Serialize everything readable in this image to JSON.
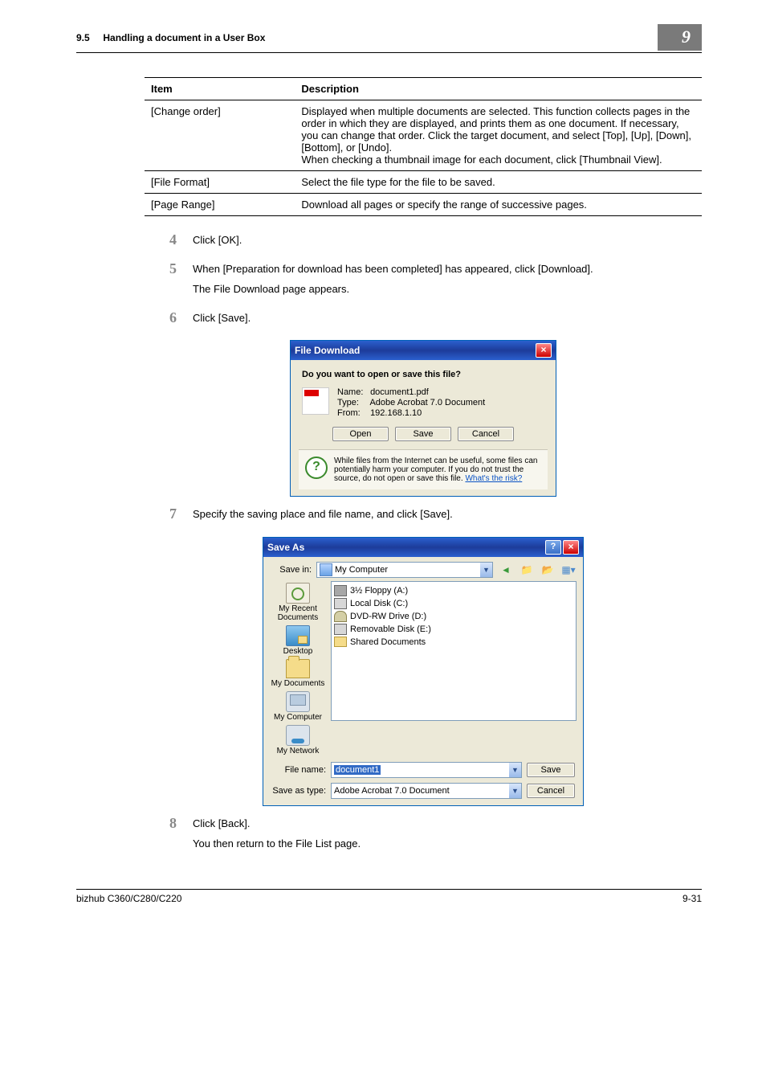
{
  "header": {
    "section": "9.5",
    "title": "Handling a document in a User Box",
    "chapter": "9"
  },
  "table": {
    "head": {
      "item": "Item",
      "description": "Description"
    },
    "rows": [
      {
        "item": "[Change order]",
        "description": "Displayed when multiple documents are selected. This function collects pages in the order in which they are displayed, and prints them as one document. If necessary, you can change that order. Click the target document, and select [Top], [Up], [Down], [Bottom], or [Undo].\nWhen checking a thumbnail image for each document, click [Thumbnail View]."
      },
      {
        "item": "[File Format]",
        "description": "Select the file type for the file to be saved."
      },
      {
        "item": "[Page Range]",
        "description": "Download all pages or specify the range of successive pages."
      }
    ]
  },
  "steps": {
    "s4": {
      "num": "4",
      "line1": "Click [OK]."
    },
    "s5": {
      "num": "5",
      "line1": "When [Preparation for download has been completed] has appeared, click [Download].",
      "line2": "The File Download page appears."
    },
    "s6": {
      "num": "6",
      "line1": "Click [Save]."
    },
    "s7": {
      "num": "7",
      "line1": "Specify the saving place and file name, and click [Save]."
    },
    "s8": {
      "num": "8",
      "line1": "Click [Back].",
      "line2": "You then return to the File List page."
    }
  },
  "fileDownload": {
    "title": "File Download",
    "prompt": "Do you want to open or save this file?",
    "nameLabel": "Name:",
    "nameValue": "document1.pdf",
    "typeLabel": "Type:",
    "typeValue": "Adobe Acrobat 7.0 Document",
    "fromLabel": "From:",
    "fromValue": "192.168.1.10",
    "open": "Open",
    "save": "Save",
    "cancel": "Cancel",
    "warning": "While files from the Internet can be useful, some files can potentially harm your computer. If you do not trust the source, do not open or save this file. ",
    "warnLink": "What's the risk?"
  },
  "saveAs": {
    "title": "Save As",
    "saveInLabel": "Save in:",
    "saveInValue": "My Computer",
    "places": {
      "recent": "My Recent Documents",
      "desktop": "Desktop",
      "mydocs": "My Documents",
      "mycomp": "My Computer",
      "mynet": "My Network"
    },
    "drives": {
      "a": "3½ Floppy (A:)",
      "c": "Local Disk (C:)",
      "d": "DVD-RW Drive (D:)",
      "e": "Removable Disk (E:)",
      "shared": "Shared Documents"
    },
    "fileNameLabel": "File name:",
    "fileNameValue": "document1",
    "saveTypeLabel": "Save as type:",
    "saveTypeValue": "Adobe Acrobat 7.0 Document",
    "saveBtn": "Save",
    "cancelBtn": "Cancel"
  },
  "footer": {
    "left": "bizhub C360/C280/C220",
    "right": "9-31"
  }
}
